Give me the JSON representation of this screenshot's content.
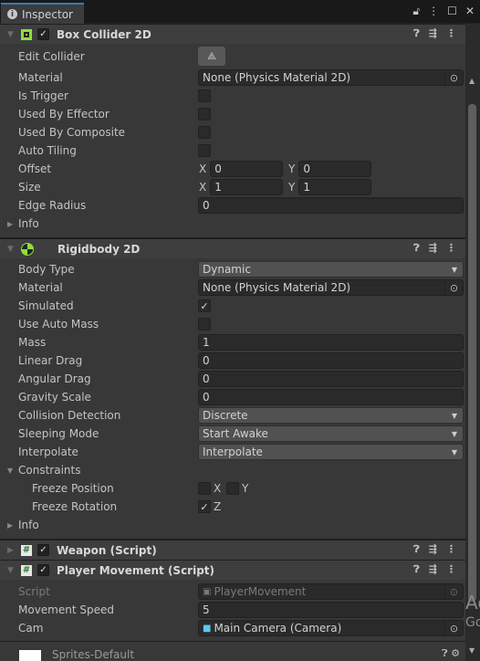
{
  "tab": {
    "title": "Inspector",
    "icons": [
      "lock-icon",
      "more-icon",
      "maximize-icon",
      "close-icon"
    ]
  },
  "box_collider": {
    "title": "Box Collider 2D",
    "enabled": true,
    "edit_collider": "Edit Collider",
    "material_label": "Material",
    "material_value": "None (Physics Material 2D)",
    "is_trigger": "Is Trigger",
    "used_by_effector": "Used By Effector",
    "used_by_composite": "Used By Composite",
    "auto_tiling": "Auto Tiling",
    "offset": "Offset",
    "offset_x": "0",
    "offset_y": "0",
    "size": "Size",
    "size_x": "1",
    "size_y": "1",
    "edge_radius": "Edge Radius",
    "edge_radius_value": "0",
    "info": "Info",
    "x": "X",
    "y": "Y"
  },
  "rigidbody": {
    "title": "Rigidbody 2D",
    "body_type": "Body Type",
    "body_type_value": "Dynamic",
    "material": "Material",
    "material_value": "None (Physics Material 2D)",
    "simulated": "Simulated",
    "use_auto_mass": "Use Auto Mass",
    "mass": "Mass",
    "mass_value": "1",
    "linear_drag": "Linear Drag",
    "linear_drag_value": "0",
    "angular_drag": "Angular Drag",
    "angular_drag_value": "0",
    "gravity_scale": "Gravity Scale",
    "gravity_scale_value": "0",
    "collision_detection": "Collision Detection",
    "collision_detection_value": "Discrete",
    "sleeping_mode": "Sleeping Mode",
    "sleeping_mode_value": "Start Awake",
    "interpolate": "Interpolate",
    "interpolate_value": "Interpolate",
    "constraints": "Constraints",
    "freeze_position": "Freeze Position",
    "freeze_rotation": "Freeze Rotation",
    "x": "X",
    "y": "Y",
    "z": "Z",
    "info": "Info"
  },
  "weapon": {
    "title": "Weapon (Script)",
    "enabled": true
  },
  "player_movement": {
    "title": "Player Movement (Script)",
    "enabled": true,
    "script": "Script",
    "script_value": "PlayerMovement",
    "movement_speed": "Movement Speed",
    "movement_speed_value": "5",
    "cam": "Cam",
    "cam_value": "Main Camera (Camera)"
  },
  "material_footer": {
    "name": "Sprites-Default"
  },
  "side_text": [
    "Ac",
    "Go"
  ],
  "colors": {
    "accent": "#3a79bb",
    "component_icon": "#8ee03b"
  }
}
